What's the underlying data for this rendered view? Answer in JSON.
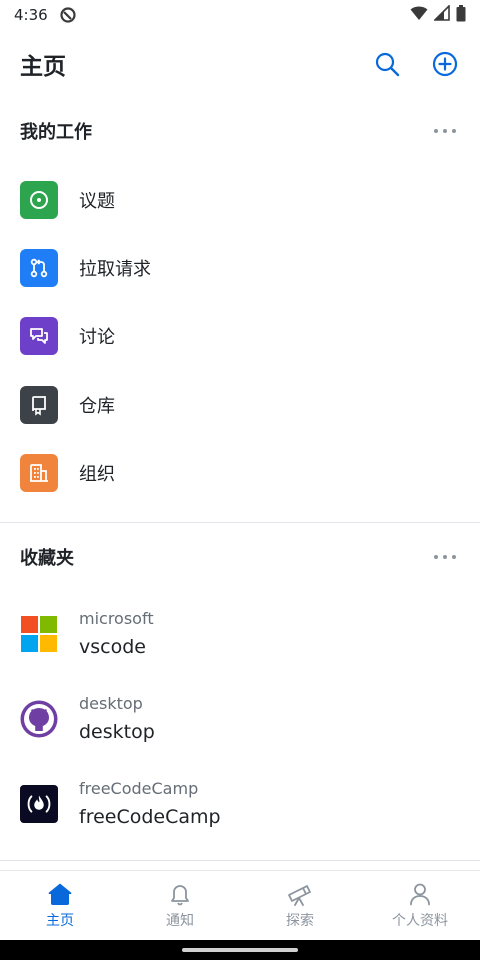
{
  "status_bar": {
    "time": "4:36",
    "icons": [
      "block-notification-icon",
      "wifi-icon",
      "signal-icon",
      "battery-icon"
    ]
  },
  "header": {
    "title": "主页",
    "actions": [
      "search-icon",
      "add-circle-icon"
    ]
  },
  "my_work": {
    "title": "我的工作",
    "items": [
      {
        "label": "议题",
        "icon": "issue-icon",
        "color": "#2da44e"
      },
      {
        "label": "拉取请求",
        "icon": "pull-request-icon",
        "color": "#1f7ef5"
      },
      {
        "label": "讨论",
        "icon": "discussion-icon",
        "color": "#6e40c9"
      },
      {
        "label": "仓库",
        "icon": "repo-icon",
        "color": "#3d4148"
      },
      {
        "label": "组织",
        "icon": "organization-icon",
        "color": "#f0843c"
      }
    ]
  },
  "favorites": {
    "title": "收藏夹",
    "items": [
      {
        "owner": "microsoft",
        "name": "vscode",
        "icon": "microsoft-logo-icon"
      },
      {
        "owner": "desktop",
        "name": "desktop",
        "icon": "github-desktop-avatar-icon"
      },
      {
        "owner": "freeCodeCamp",
        "name": "freeCodeCamp",
        "icon": "freecodecamp-logo-icon"
      }
    ]
  },
  "bottom_nav": {
    "items": [
      {
        "label": "主页",
        "icon": "home-icon",
        "active": true
      },
      {
        "label": "通知",
        "icon": "bell-icon",
        "active": false
      },
      {
        "label": "探索",
        "icon": "telescope-icon",
        "active": false
      },
      {
        "label": "个人资料",
        "icon": "person-icon",
        "active": false
      }
    ]
  },
  "colors": {
    "accent": "#0969da",
    "text_primary": "#1f2328",
    "text_secondary": "#656d76",
    "nav_inactive": "#8c959f"
  }
}
